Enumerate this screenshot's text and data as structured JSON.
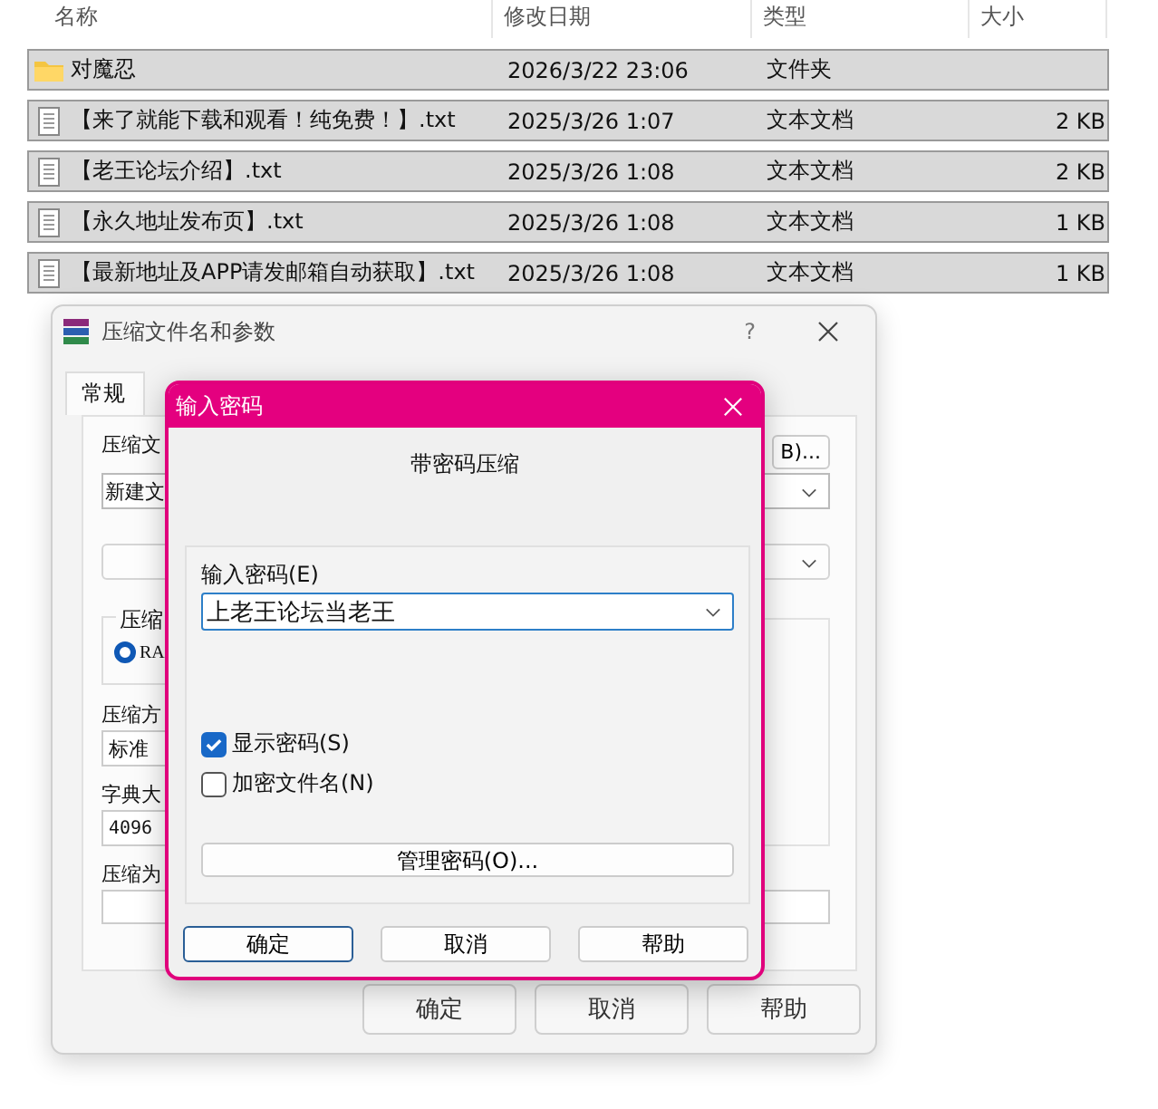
{
  "file_list": {
    "columns": [
      "名称",
      "修改日期",
      "类型",
      "大小"
    ],
    "rows": [
      {
        "kind": "folder",
        "name": "对魔忍",
        "modified": "2026/3/22 23:06",
        "type": "文件夹",
        "selected": true
      },
      {
        "kind": "text",
        "name": "【来了就能下载和观看！纯免费！】.txt",
        "modified": "2025/3/26 1:07",
        "type": "文本文档",
        "size": "2 KB",
        "selected": true
      },
      {
        "kind": "text",
        "name": "【老王论坛介绍】.txt",
        "modified": "2025/3/26 1:08",
        "type": "文本文档",
        "size": "2 KB",
        "selected": true
      },
      {
        "kind": "text",
        "name": "【永久地址发布页】.txt",
        "modified": "2025/3/26 1:08",
        "type": "文本文档",
        "size": "1 KB",
        "selected": true
      },
      {
        "kind": "text",
        "name": "【最新地址及APP请发邮箱自动获取】.txt",
        "modified": "2025/3/26 1:08",
        "type": "文本文档",
        "size": "1 KB",
        "selected": true
      }
    ]
  },
  "archive_dialog": {
    "title": "压缩文件名和参数",
    "help": "?",
    "tabs": [
      {
        "label": "常规",
        "selected": true
      }
    ],
    "archive_label": "压缩文",
    "archive_name": "新建文",
    "browse_button": "B)...",
    "format_group": {
      "legend": "压缩",
      "option": {
        "label": "RA",
        "selected": true
      }
    },
    "method_label": "压缩方",
    "method_value": "标准",
    "dictionary_label": "字典大",
    "dictionary_value": "4096",
    "split_label": "压缩为",
    "buttons": [
      "确定",
      "取消",
      "帮助"
    ]
  },
  "password_dialog": {
    "title": "输入密码",
    "heading": "带密码压缩",
    "password_label": "输入密码(E)",
    "password_value": "上老王论坛当老王",
    "options": [
      {
        "label": "显示密码(S)",
        "checked": true
      },
      {
        "label": "加密文件名(N)",
        "checked": false
      }
    ],
    "manage_button": "管理密码(O)...",
    "buttons": [
      {
        "label": "确定",
        "default": true
      },
      {
        "label": "取消",
        "default": false
      },
      {
        "label": "帮助",
        "default": false
      }
    ]
  }
}
